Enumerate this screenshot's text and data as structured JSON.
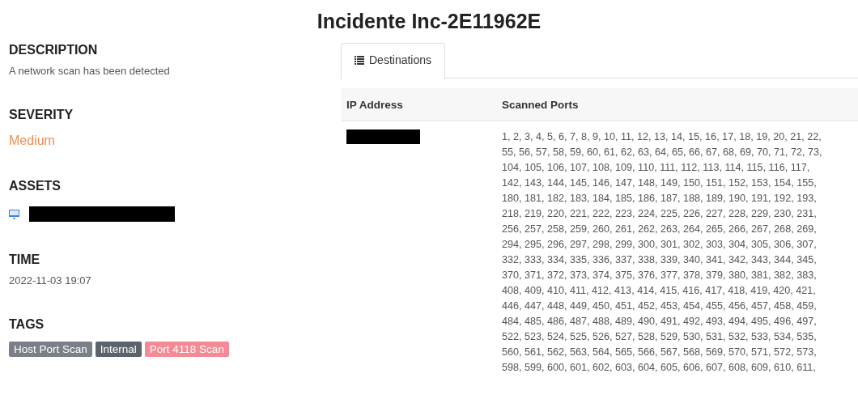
{
  "title": "Incidente Inc-2E11962E",
  "details": {
    "description_label": "DESCRIPTION",
    "description": "A network scan has been detected",
    "severity_label": "SEVERITY",
    "severity": "Medium",
    "assets_label": "ASSETS",
    "time_label": "TIME",
    "time": "2022-11-03 19:07",
    "tags_label": "TAGS",
    "tags": [
      {
        "label": "Host Port Scan",
        "color": "#7b8088"
      },
      {
        "label": "Internal",
        "color": "#5b636c"
      },
      {
        "label": "Port 4118 Scan",
        "color": "#f48a94"
      }
    ]
  },
  "tabs": [
    {
      "label": "Destinations",
      "selected": true
    }
  ],
  "table": {
    "columns": [
      "IP Address",
      "Scanned Ports"
    ],
    "rows": [
      {
        "ports_lines": [
          "1, 2, 3, 4, 5, 6, 7, 8, 9, 10, 11, 12, 13, 14, 15, 16, 17, 18, 19, 20, 21, 22,",
          "55, 56, 57, 58, 59, 60, 61, 62, 63, 64, 65, 66, 67, 68, 69, 70, 71, 72, 73,",
          "104, 105, 106, 107, 108, 109, 110, 111, 112, 113, 114, 115, 116, 117,",
          "142, 143, 144, 145, 146, 147, 148, 149, 150, 151, 152, 153, 154, 155,",
          "180, 181, 182, 183, 184, 185, 186, 187, 188, 189, 190, 191, 192, 193,",
          "218, 219, 220, 221, 222, 223, 224, 225, 226, 227, 228, 229, 230, 231,",
          "256, 257, 258, 259, 260, 261, 262, 263, 264, 265, 266, 267, 268, 269,",
          "294, 295, 296, 297, 298, 299, 300, 301, 302, 303, 304, 305, 306, 307,",
          "332, 333, 334, 335, 336, 337, 338, 339, 340, 341, 342, 343, 344, 345,",
          "370, 371, 372, 373, 374, 375, 376, 377, 378, 379, 380, 381, 382, 383,",
          "408, 409, 410, 411, 412, 413, 414, 415, 416, 417, 418, 419, 420, 421,",
          "446, 447, 448, 449, 450, 451, 452, 453, 454, 455, 456, 457, 458, 459,",
          "484, 485, 486, 487, 488, 489, 490, 491, 492, 493, 494, 495, 496, 497,",
          "522, 523, 524, 525, 526, 527, 528, 529, 530, 531, 532, 533, 534, 535,",
          "560, 561, 562, 563, 564, 565, 566, 567, 568, 569, 570, 571, 572, 573,",
          "598, 599, 600, 601, 602, 603, 604, 605, 606, 607, 608, 609, 610, 611,"
        ]
      }
    ]
  }
}
